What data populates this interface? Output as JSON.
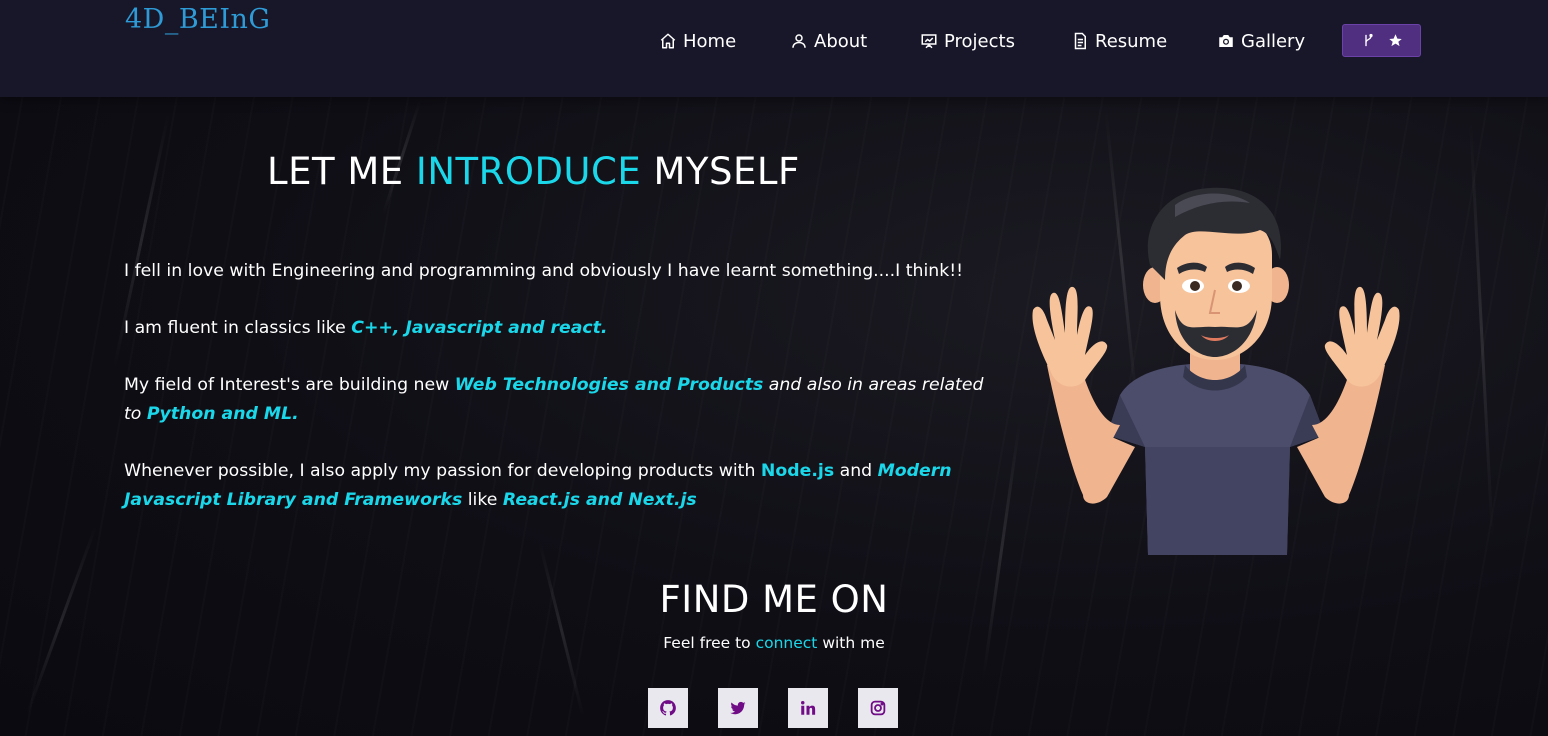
{
  "brand": "4D_BEInG",
  "nav": {
    "home": "Home",
    "about": "About",
    "projects": "Projects",
    "resume": "Resume",
    "gallery": "Gallery"
  },
  "intro": {
    "title_pre": "LET ME ",
    "title_accent": "INTRODUCE",
    "title_post": " MYSELF",
    "p1": "I fell in love with Engineering and programming and obviously I have learnt something....I think!!",
    "p2_pre": "I am fluent in classics like ",
    "p2_hl": "C++, Javascript and react.",
    "p3_pre": "My field of Interest's are building new ",
    "p3_hl1": "Web Technologies and Products",
    "p3_mid": " and also in areas related to ",
    "p3_hl2": "Python and ML.",
    "p4_pre": "Whenever possible, I also apply my passion for developing products with ",
    "p4_hl1": "Node.js",
    "p4_mid": " and ",
    "p4_hl2": "Modern Javascript Library and Frameworks",
    "p4_mid2": "  like ",
    "p4_hl3": "React.js and Next.js"
  },
  "find": {
    "title": "FIND ME ON",
    "sub_pre": "Feel free to ",
    "sub_accent": "connect",
    "sub_post": " with me"
  },
  "icons": {
    "social": [
      "github-icon",
      "twitter-icon",
      "linkedin-icon",
      "instagram-icon"
    ],
    "nav": [
      "home-icon",
      "user-icon",
      "projects-icon",
      "resume-icon",
      "camera-icon"
    ],
    "fork_button": [
      "git-fork-icon",
      "star-icon"
    ]
  },
  "colors": {
    "accent": "#1ad8ea",
    "brand": "#2f9bd6",
    "navbar_bg": "#18172a",
    "fork_button_bg": "#502e80",
    "social_icon": "#700c86"
  }
}
